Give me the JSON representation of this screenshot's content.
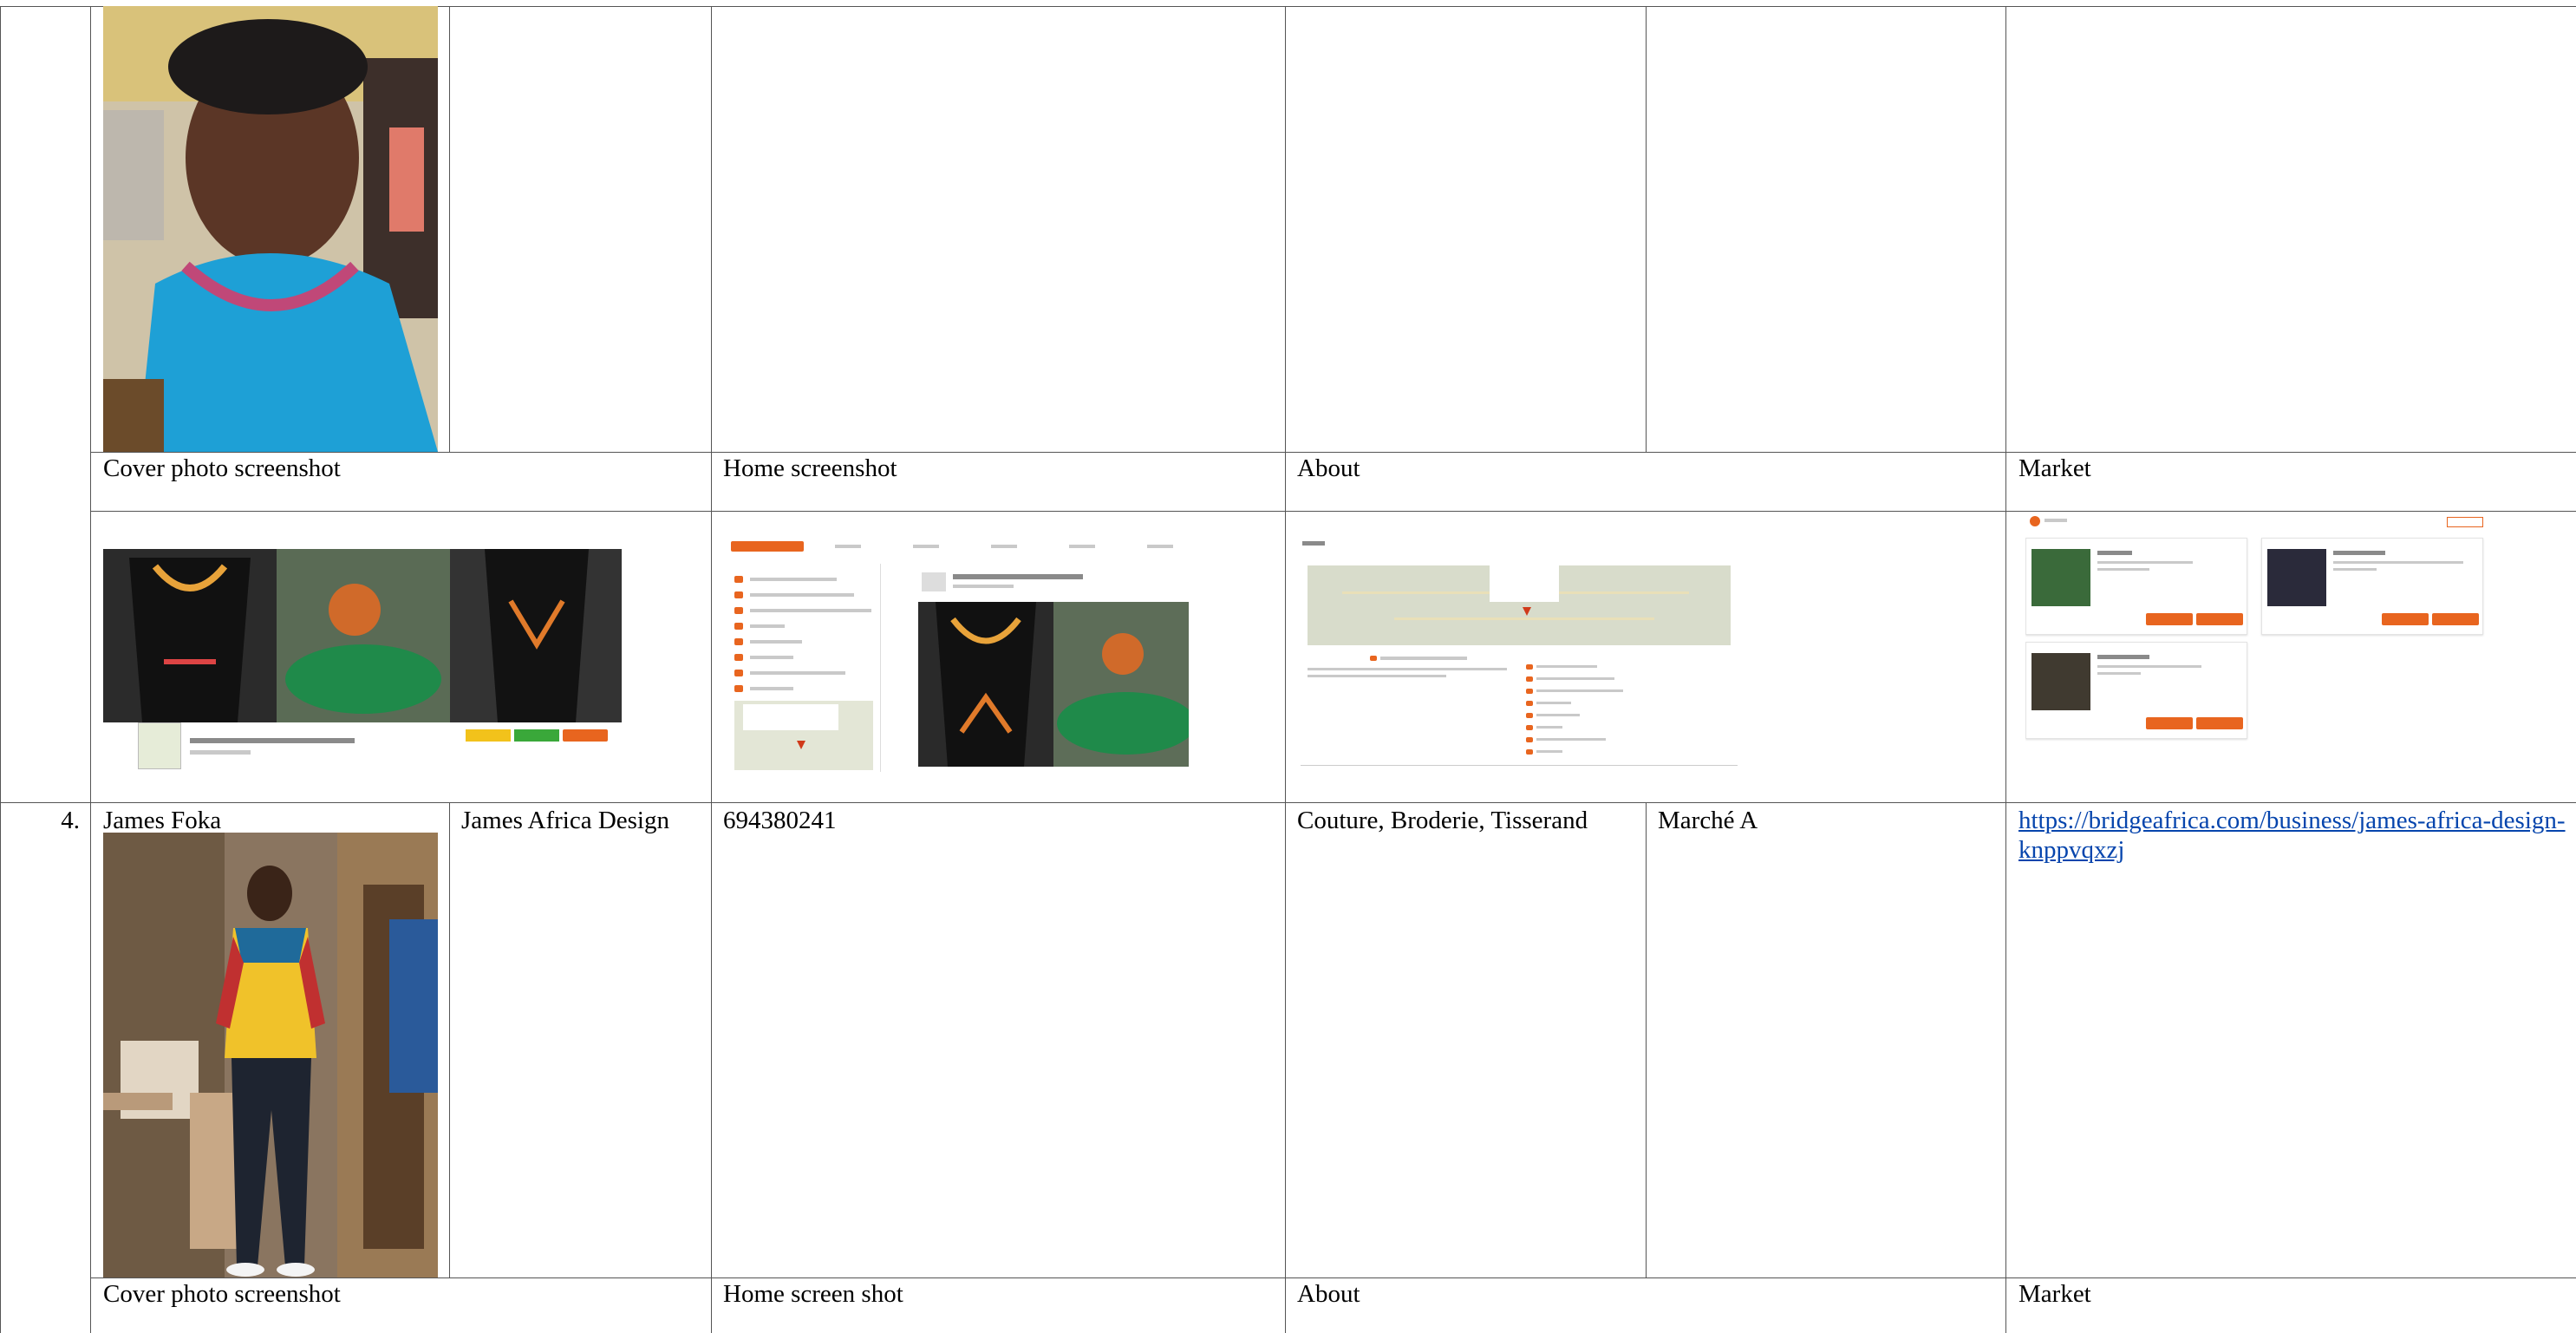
{
  "rows": [
    {
      "number": "",
      "labels": {
        "cover": "Cover photo screenshot",
        "home": "Home screenshot",
        "about": "About",
        "market": "Market"
      }
    },
    {
      "number": "4.",
      "owner_name": "James Foka",
      "business_name": "James Africa Design",
      "phone": "694380241",
      "category": "Couture, Broderie, Tisserand",
      "location": "Marché A",
      "url": "https://bridgeafrica.com/business/james-africa-design-knppvqxzj",
      "labels": {
        "cover": "Cover photo screenshot",
        "home": "Home screen shot",
        "about": "About",
        "market": "Market"
      }
    }
  ],
  "colors": {
    "accent": "#e8651f",
    "link": "#0645ad",
    "grid": "#555555"
  },
  "icons": [
    "portrait-photo-icon",
    "map-pin-icon",
    "shop-logo-icon"
  ]
}
